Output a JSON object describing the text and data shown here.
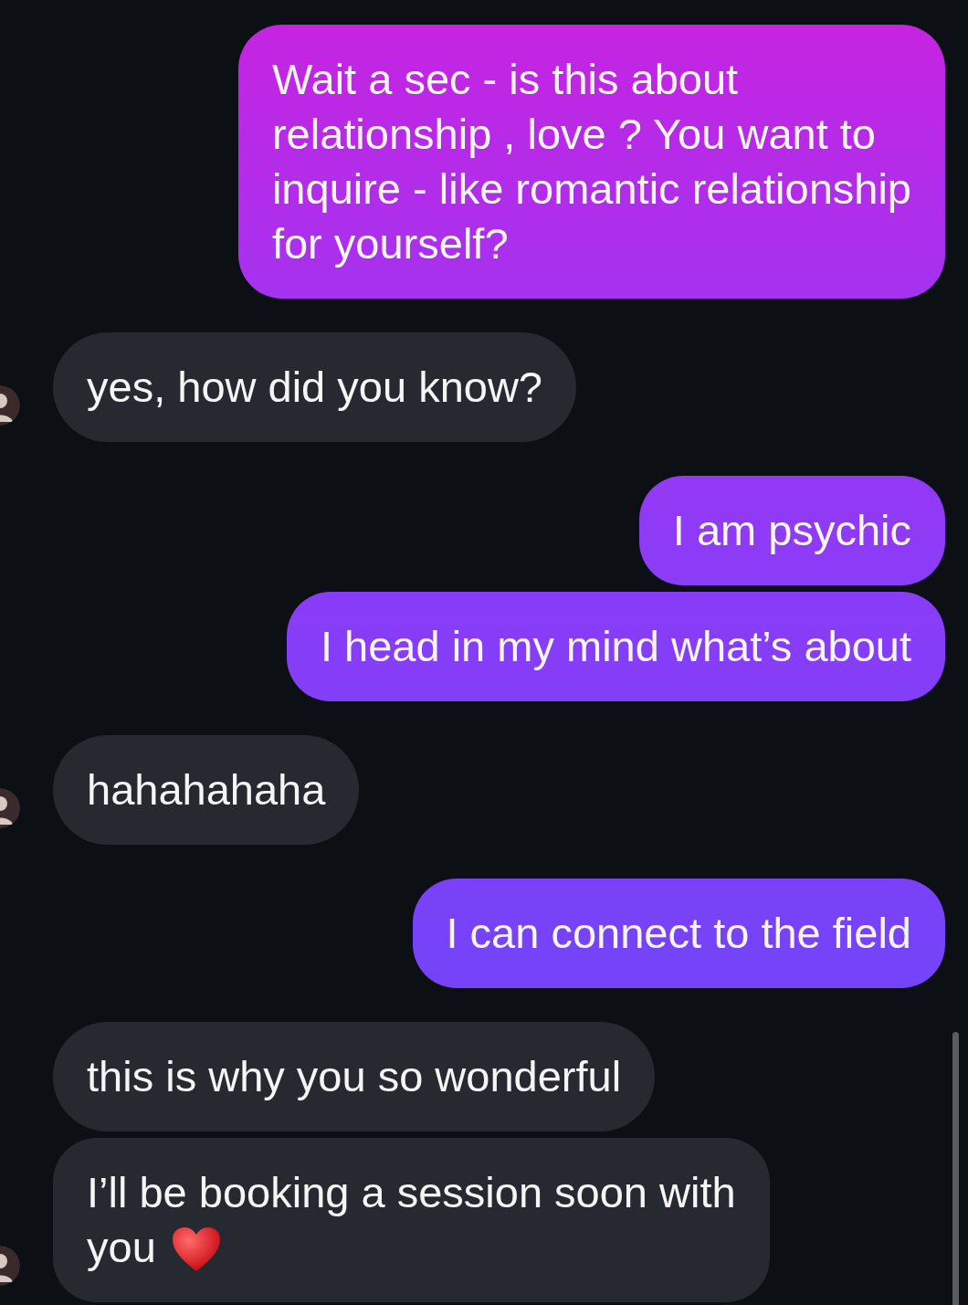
{
  "messages": [
    {
      "kind": "sent",
      "text": "Wait a sec - is this about\nrelationship , love ? You want to\ninquire - like romantic relationship\nfor yourself?"
    },
    {
      "kind": "received",
      "text": "yes, how did you know?",
      "avatar": true
    },
    {
      "kind": "sent",
      "text": "I am psychic"
    },
    {
      "kind": "sent",
      "text": "I head in my mind what’s about"
    },
    {
      "kind": "received",
      "text": "hahahahaha",
      "avatar": true
    },
    {
      "kind": "sent",
      "text": "I can connect to the field"
    },
    {
      "kind": "received",
      "text": "this is why you so wonderful",
      "avatar": false
    },
    {
      "kind": "received",
      "text": "I’ll be booking a session soon with\nyou",
      "avatar": true,
      "trailing_heart": true
    }
  ]
}
